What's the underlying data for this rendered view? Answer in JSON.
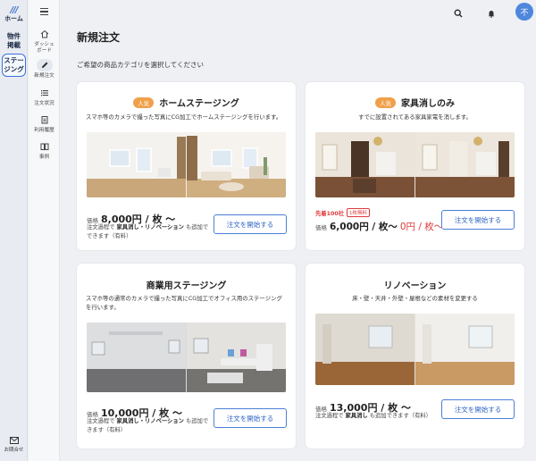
{
  "rail": {
    "logo": "///",
    "home_label": "ホーム",
    "items": [
      {
        "label": "物件\n掲載"
      },
      {
        "label": "ステー\nジング"
      }
    ],
    "contact_label": "お問合せ"
  },
  "sidebar": {
    "items": [
      {
        "label": "ダッシュ\nボード",
        "icon": "home-icon"
      },
      {
        "label": "新規注文",
        "icon": "pencil-icon"
      },
      {
        "label": "注文状況",
        "icon": "list-icon"
      },
      {
        "label": "利用履歴",
        "icon": "clipboard-icon"
      },
      {
        "label": "事例",
        "icon": "book-icon"
      }
    ]
  },
  "header": {
    "avatar_initial": "不"
  },
  "page": {
    "title": "新規注文",
    "subtitle": "ご希望の商品カテゴリを選択してください"
  },
  "cards": {
    "home_staging": {
      "badge": "人気",
      "title": "ホームステージング",
      "desc": "スマホ等のカメラで撮った写真にCG加工でホームステージングを行います。",
      "price_label": "価格",
      "price": "8,000円 / 枚 〜",
      "note_a": "注文過程で ",
      "note_b": "家具消し・リノベーション",
      "note_c": " も追加で",
      "note_d": "できます（有料）",
      "button": "注文を開始する"
    },
    "furniture_removal": {
      "badge": "人気",
      "title": "家具消しのみ",
      "desc": "すでに設置されてある家具家電を消します。",
      "promo": "先着100社",
      "promo_tag": "1枚無料",
      "price_label": "価格",
      "price": "6,000円 / 枚〜",
      "price_free": "0円 / 枚〜",
      "button": "注文を開始する"
    },
    "commercial": {
      "title": "商業用ステージング",
      "desc": "スマホ等の通常のカメラで撮った写真にCG加工でオフィス用のステージングを行います。",
      "price_label": "価格",
      "price": "10,000円 / 枚 〜",
      "note_a": "注文過程で ",
      "note_b": "家具消し・リノベーション",
      "note_c": " も追加で",
      "note_d": "きます（有料）",
      "button": "注文を開始する"
    },
    "renovation": {
      "title": "リノベーション",
      "desc": "床・壁・天井・外壁・屋根などの素材を変更する",
      "price_label": "価格",
      "price": "13,000円 / 枚 〜",
      "note_a": "注文過程で ",
      "note_b": "家具消し",
      "note_c": " も追加できます（有料）",
      "button": "注文を開始する"
    }
  },
  "colors": {
    "accent": "#4a7fd6",
    "badge": "#f0a04a",
    "promo": "#e03b3b"
  }
}
